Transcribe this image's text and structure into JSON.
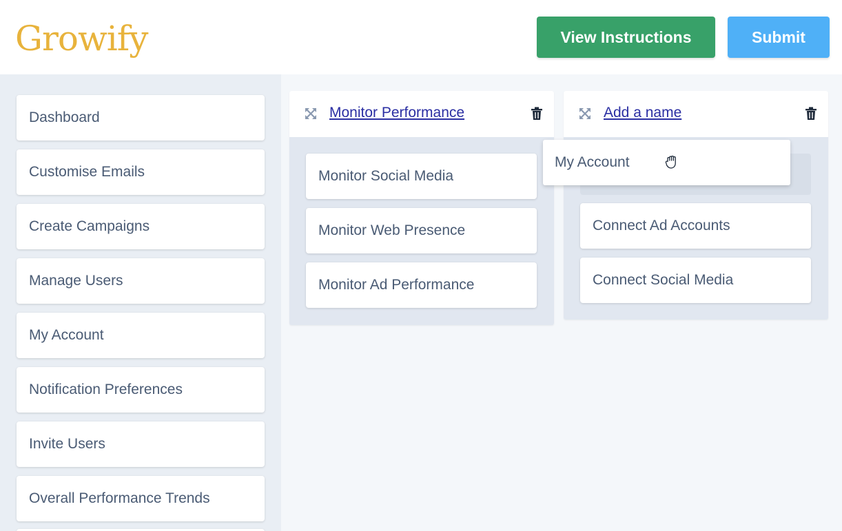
{
  "header": {
    "logo": "Growify",
    "instructions_label": "View Instructions",
    "submit_label": "Submit"
  },
  "sidebar": {
    "items": [
      {
        "label": "Dashboard"
      },
      {
        "label": "Customise Emails"
      },
      {
        "label": "Create Campaigns"
      },
      {
        "label": "Manage Users"
      },
      {
        "label": "My Account"
      },
      {
        "label": "Notification Preferences"
      },
      {
        "label": "Invite Users"
      },
      {
        "label": "Overall Performance Trends"
      }
    ]
  },
  "groups": [
    {
      "title": "Monitor Performance",
      "cards": [
        {
          "label": "Monitor Social Media"
        },
        {
          "label": "Monitor Web Presence"
        },
        {
          "label": "Monitor Ad Performance"
        }
      ]
    },
    {
      "title": "Add a name",
      "cards": [
        {
          "label": "Connect Ad Accounts"
        },
        {
          "label": "Connect Social Media"
        }
      ]
    }
  ],
  "dragging": {
    "label": "My Account"
  },
  "colors": {
    "brand": "#e8b33c",
    "instructions_button": "#38a169",
    "submit_button": "#4fb0f7",
    "link": "#2b2fa3"
  },
  "icons": [
    "move-icon",
    "trash-icon",
    "grab-hand-icon"
  ]
}
